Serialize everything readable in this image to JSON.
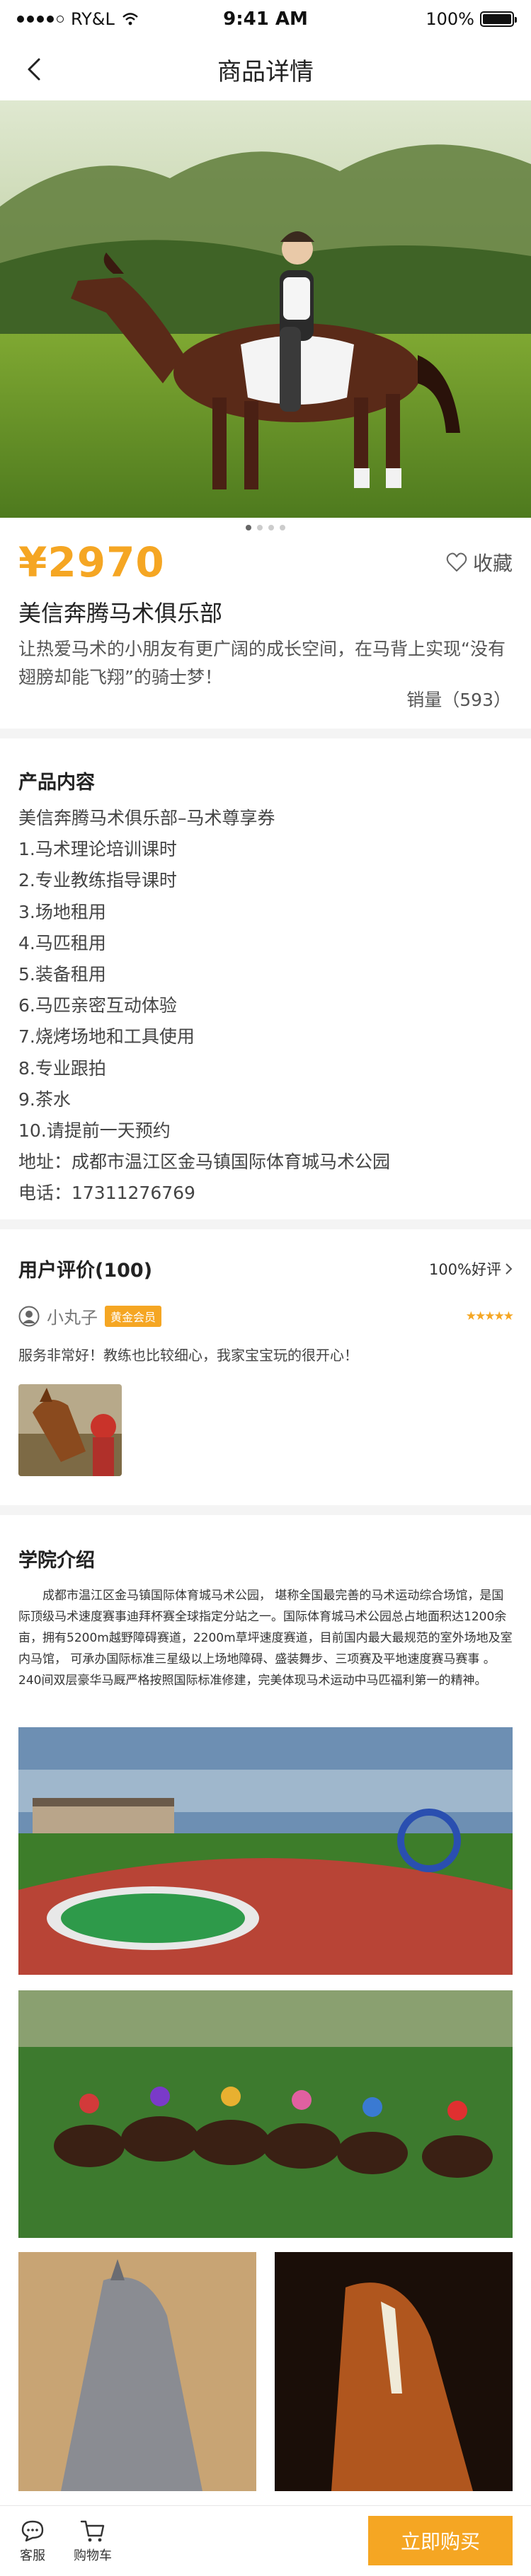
{
  "status_bar": {
    "carrier": "RY&L",
    "time": "9:41 AM",
    "battery": "100%",
    "battery_level": 1.0
  },
  "nav": {
    "title": "商品详情",
    "back_icon": "chevron-left-icon"
  },
  "hero": {
    "page_count": 4,
    "active_page": 1
  },
  "product": {
    "price": "¥2970",
    "favorite_label": "收藏",
    "title": "美信奔腾马术俱乐部",
    "description": "让热爱马术的小朋友有更广阔的成长空间，在马背上实现“没有翅膀却能飞翔”的骑士梦！",
    "sales": "销量（593）"
  },
  "content": {
    "heading": "产品内容",
    "items": [
      "美信奔腾马术俱乐部–马术尊享券",
      "1.马术理论培训课时",
      "2.专业教练指导课时",
      "3.场地租用",
      "4.马匹租用",
      "5.装备租用",
      "6.马匹亲密互动体验",
      "7.烧烤场地和工具使用",
      "8.专业跟拍",
      "9.茶水",
      "10.请提前一天预约",
      "地址：成都市温江区金马镇国际体育城马术公园",
      "电话：17311276769"
    ]
  },
  "review": {
    "heading": "用户评价(100)",
    "rate": "100%好评",
    "user_name": "小丸子",
    "badge": "黄金会员",
    "stars": "★★★★★",
    "rating": 5,
    "comment": "服务非常好！教练也比较细心，我家宝宝玩的很开心！"
  },
  "intro": {
    "heading": "学院介绍",
    "text": "成都市温江区金马镇国际体育城马术公园， 堪称全国最完善的马术运动综合场馆，是国际顶级马术速度赛事迪拜杯赛全球指定分站之一。国际体育城马术公园总占地面积达1200余亩，拥有5200m越野障碍赛道，2200m草坪速度赛道，目前国内最大最规范的室外场地及室内马馆， 可承办国际标准三星级以上场地障碍、盛装舞步、三项赛及平地速度赛马赛事 。240间双层豪华马厩严格按照国际标准修建，完美体现马术运动中马匹福利第一的精神。"
  },
  "bottom_bar": {
    "service_label": "客服",
    "cart_label": "购物车",
    "buy_label": "立即购买"
  },
  "colors": {
    "accent": "#f5a623",
    "background": "#f4f4f4"
  }
}
